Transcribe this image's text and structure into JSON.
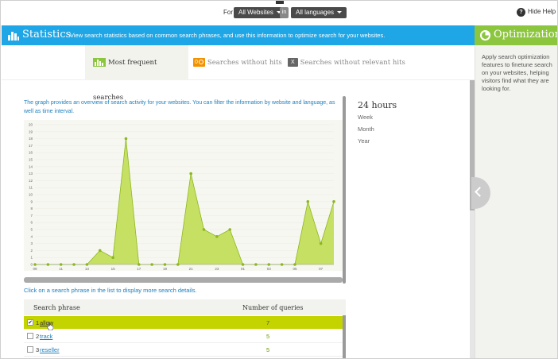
{
  "topbar": {
    "for_label": "For",
    "website_select": "All Websites",
    "in_label": "in",
    "language_select": "All languages",
    "help_label": "Hide Help"
  },
  "statistics": {
    "title": "Statistics",
    "description": "View search statistics based on common search phrases, and use this information to optimize search for your websites.",
    "accent_color": "#1ea6e6"
  },
  "optimization": {
    "title": "Optimization",
    "text": "Apply search optimization features to finetune search on your websites, helping visitors find what they are looking for.",
    "accent_color": "#8cc63f"
  },
  "tabs": [
    {
      "label": "Most frequent searches",
      "badge": "",
      "active": true,
      "icon": "bar-chart-icon"
    },
    {
      "label": "Searches without hits",
      "badge": "0",
      "active": false,
      "icon": "zero-hits-icon"
    },
    {
      "label": "Searches without relevant hits",
      "badge": "X",
      "active": false,
      "icon": "x-icon"
    }
  ],
  "main": {
    "graph_description": "The graph provides an overview of search activity for your websites. You can filter the information by website and language, as well as time interval.",
    "click_hint": "Click on a search phrase in the list to display more search details."
  },
  "time_range": {
    "active": "24 hours",
    "options": [
      "Week",
      "Month",
      "Year"
    ]
  },
  "chart_data": {
    "type": "area",
    "color": "#c6e063",
    "line_color": "#8cb81e",
    "ylim": [
      0,
      20
    ],
    "y_ticks": [
      "0",
      "1",
      "2",
      "3",
      "4",
      "5",
      "6",
      "7",
      "8",
      "9",
      "10",
      "11",
      "12",
      "13",
      "14",
      "15",
      "16",
      "17",
      "18",
      "19",
      "20"
    ],
    "x_tick_labels": [
      "09",
      "11",
      "13",
      "15",
      "17",
      "19",
      "21",
      "23",
      "01",
      "03",
      "05",
      "07"
    ],
    "values": [
      0,
      0,
      0,
      0,
      0,
      2,
      1,
      18,
      0,
      0,
      0,
      0,
      13,
      5,
      4,
      5,
      0,
      0,
      0,
      0,
      0,
      9,
      3,
      9
    ]
  },
  "table": {
    "headers": [
      "Search phrase",
      "Number of queries"
    ],
    "rows": [
      {
        "num": "1",
        "phrase": "allow",
        "count": "7",
        "selected": true,
        "check": "✔"
      },
      {
        "num": "2",
        "phrase": "track",
        "count": "5",
        "selected": false,
        "check": ""
      },
      {
        "num": "3",
        "phrase": "reseller",
        "count": "5",
        "selected": false,
        "check": ""
      }
    ]
  }
}
